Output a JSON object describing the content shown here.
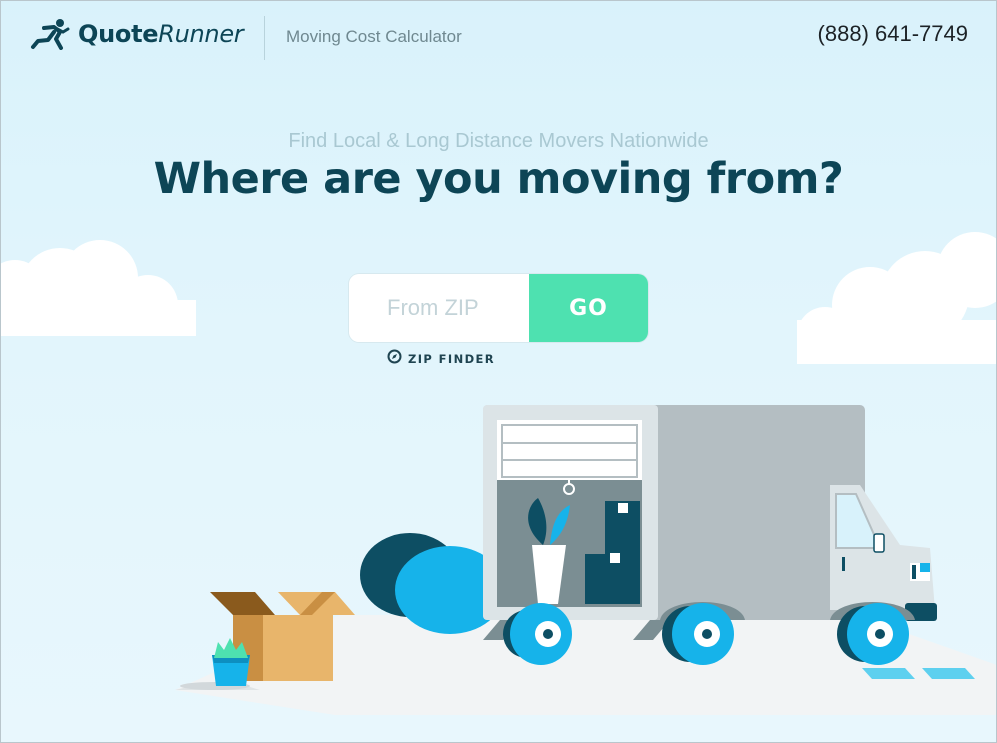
{
  "header": {
    "brand": {
      "name_part1": "Quote",
      "name_part2": "Runner"
    },
    "subtitle": "Moving Cost Calculator",
    "phone": "(888) 641-7749"
  },
  "hero": {
    "tagline": "Find Local & Long Distance Movers Nationwide",
    "title": "Where are you moving from?"
  },
  "form": {
    "zip_placeholder": "From ZIP",
    "zip_value": "",
    "go_label": "GO",
    "zip_finder_label": "ZIP FINDER"
  },
  "icons": {
    "logo": "runner-icon",
    "zip_finder": "compass-icon"
  },
  "colors": {
    "brand_dark": "#0d4556",
    "accent_green": "#4ee1b0",
    "sky": "#dff3fb",
    "truck_grey": "#b4bec2",
    "accent_blue": "#16b3ea"
  }
}
